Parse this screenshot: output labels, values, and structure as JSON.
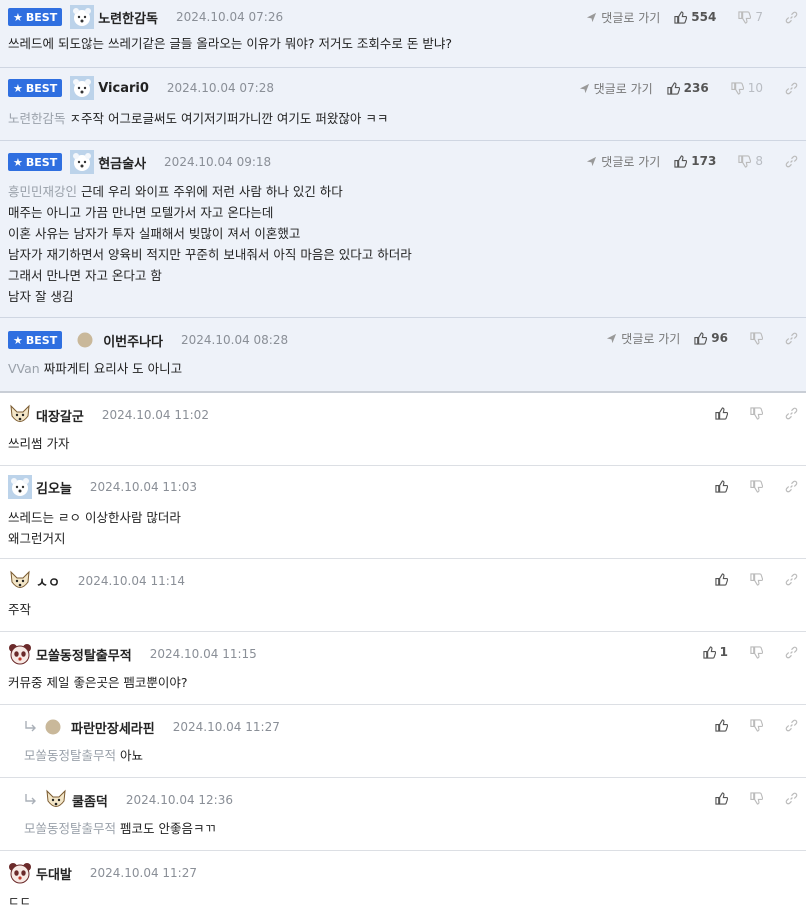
{
  "labels": {
    "best": "BEST",
    "goto_comment": "댓글로 가기"
  },
  "colors": {
    "accent": "#2f6fe0",
    "best_bg": "#eef2f9",
    "mention": "#9aa1aa"
  },
  "best_comments": [
    {
      "nick": "노련한감독",
      "date": "2024.10.04 07:26",
      "avatar_icon": "polar-bear-avatar-icon",
      "likes": "554",
      "dislikes": "7",
      "lines": [
        "쓰레드에 되도않는 쓰레기같은 글들 올라오는 이유가 뭐야? 저거도 조회수로 돈 받냐?"
      ]
    },
    {
      "nick": "Vicari0",
      "date": "2024.10.04 07:28",
      "avatar_icon": "polar-bear-avatar-icon",
      "likes": "236",
      "dislikes": "10",
      "mention": "노련한감독",
      "lines": [
        "ㅈ주작 어그로글써도 여기저기퍼가니깐 여기도 퍼왔잖아 ㅋㅋ"
      ]
    },
    {
      "nick": "현금술사",
      "date": "2024.10.04 09:18",
      "avatar_icon": "polar-bear-avatar-icon",
      "likes": "173",
      "dislikes": "8",
      "mention": "흥민민재강인",
      "lines": [
        "근데 우리 와이프 주위에 저런 사람 하나 있긴 하다",
        "매주는 아니고 가끔 만나면 모텔가서 자고 온다는데",
        "이혼 사유는 남자가 투자 실패해서 빚많이 져서 이혼했고",
        "남자가 재기하면서 양육비 적지만 꾸준히 보내줘서 아직 마음은 있다고 하더라",
        "그래서 만나면 자고 온다고 함",
        "남자 잘 생김"
      ]
    },
    {
      "nick": "이번주나다",
      "date": "2024.10.04 08:28",
      "avatar_icon": "default-dot-avatar-icon",
      "likes": "96",
      "dislikes": "",
      "mention": "VVan",
      "lines": [
        "짜파게티 요리사 도 아니고"
      ]
    }
  ],
  "comments": [
    {
      "nick": "대장갈군",
      "date": "2024.10.04 11:02",
      "avatar_icon": "dog-avatar-icon",
      "likes": "",
      "reply": false,
      "lines": [
        "쓰리썸 가자"
      ]
    },
    {
      "nick": "김오늘",
      "date": "2024.10.04 11:03",
      "avatar_icon": "polar-bear-avatar-icon",
      "likes": "",
      "reply": false,
      "lines": [
        "쓰레드는 ㄹㅇ 이상한사람 많더라",
        "왜그런거지"
      ]
    },
    {
      "nick": "ㅅㅇ",
      "date": "2024.10.04 11:14",
      "avatar_icon": "dog-avatar-icon",
      "likes": "",
      "reply": false,
      "lines": [
        "주작"
      ]
    },
    {
      "nick": "모쏠동정탈출무적",
      "date": "2024.10.04 11:15",
      "avatar_icon": "panda-avatar-icon",
      "likes": "1",
      "reply": false,
      "lines": [
        "커뮤중 제일 좋은곳은 펨코뿐이야?"
      ]
    },
    {
      "nick": "파란만장세라핀",
      "date": "2024.10.04 11:27",
      "avatar_icon": "default-dot-avatar-icon",
      "likes": "",
      "reply": true,
      "mention": "모쏠동정탈출무적",
      "lines": [
        "아뇨"
      ]
    },
    {
      "nick": "쿨좀덕",
      "date": "2024.10.04 12:36",
      "avatar_icon": "dog-avatar-icon",
      "likes": "",
      "reply": true,
      "mention": "모쏠동정탈출무적",
      "lines": [
        "펨코도 안좋음ㅋㄲ"
      ]
    },
    {
      "nick": "두대발",
      "date": "2024.10.04 11:27",
      "avatar_icon": "panda-avatar-icon",
      "likes": "",
      "reply": false,
      "lines": [
        "ㄷㄷ"
      ]
    }
  ]
}
